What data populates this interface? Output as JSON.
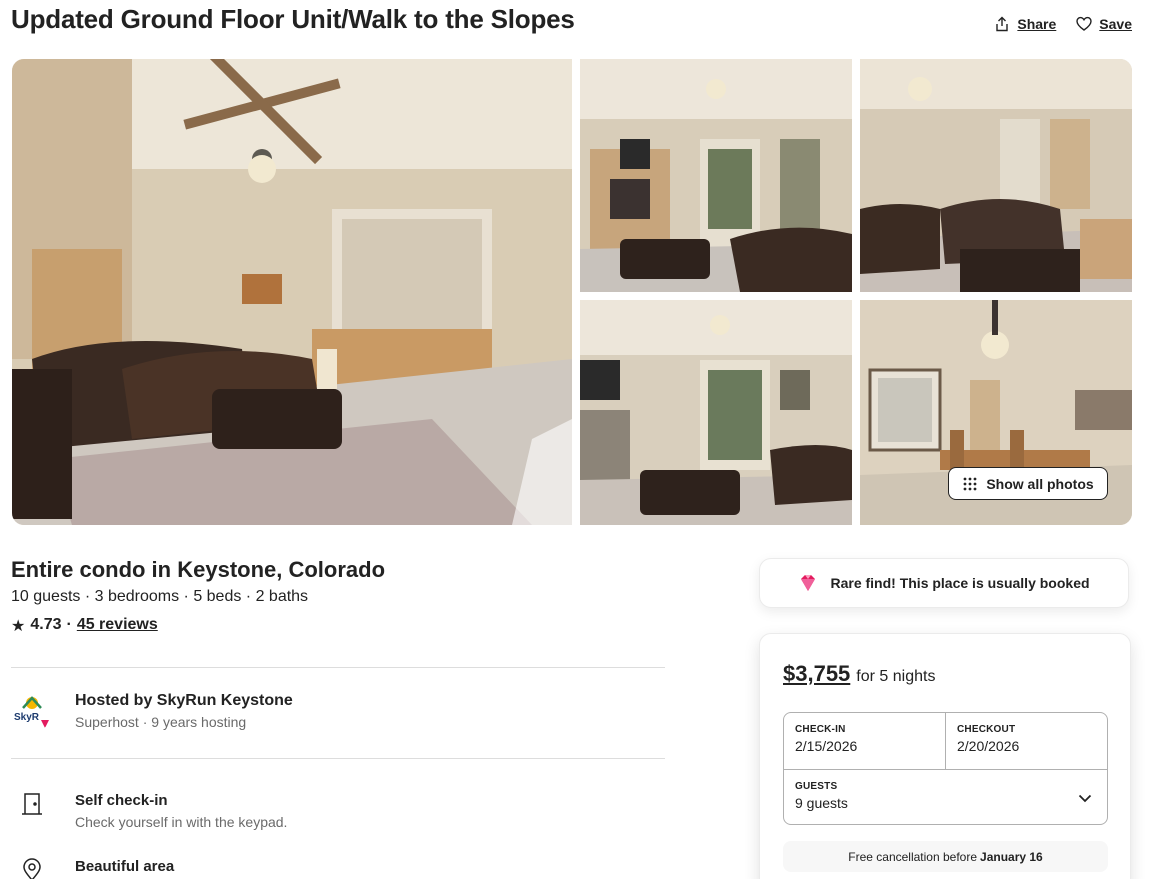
{
  "header": {
    "title": "Updated Ground Floor Unit/Walk to the Slopes",
    "share_label": "Share",
    "save_label": "Save"
  },
  "gallery": {
    "show_all_label": "Show all photos"
  },
  "listing": {
    "title": "Entire condo in Keystone, Colorado",
    "details": "10 guests · 3 bedrooms · 5 beds · 2 baths",
    "rating": "4.73",
    "separator": "·",
    "reviews": "45 reviews"
  },
  "host": {
    "name": "Hosted by SkyRun Keystone",
    "meta": "Superhost · 9 years hosting",
    "logo_text": "SkyR"
  },
  "features": [
    {
      "icon": "door-icon",
      "title": "Self check-in",
      "desc": "Check yourself in with the keypad."
    },
    {
      "icon": "map-pin-icon",
      "title": "Beautiful area",
      "desc": ""
    }
  ],
  "rare_find": {
    "text": "Rare find! This place is usually booked",
    "icon": "gem-icon"
  },
  "booking": {
    "price": "$3,755",
    "price_suffix": "for 5 nights",
    "checkin_label": "CHECK-IN",
    "checkin_value": "2/15/2026",
    "checkout_label": "CHECKOUT",
    "checkout_value": "2/20/2026",
    "guests_label": "GUESTS",
    "guests_value": "9 guests",
    "cancel_prefix": "Free cancellation before",
    "cancel_date": "January 16"
  },
  "colors": {
    "text": "#222222",
    "muted": "#6a6a6a",
    "border": "#dddddd",
    "brand_pink": "#e31c5f"
  }
}
